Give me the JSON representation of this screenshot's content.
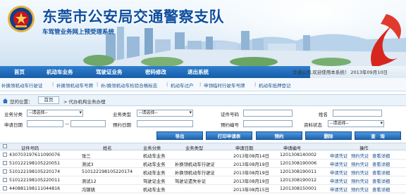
{
  "header": {
    "title": "东莞市公安局交通警察支队",
    "subtitle": "车驾管业务网上预受理系统",
    "welcome": "华通公司,欢迎使用本系统！ 2013年09月10日"
  },
  "main_nav": [
    "首页",
    "机动车业务",
    "驾驶证业务",
    "密码修改",
    "退出系统"
  ],
  "sub_nav": [
    "补换领机动车行驶证",
    "补换领机动车号牌",
    "补/换领机动车检验合格标志",
    "机动车过户",
    "申领临时行驶车号牌",
    "机动车抵押登记"
  ],
  "breadcrumb": {
    "label": "您的位置：",
    "home": "首页",
    "path": "> 代办机构业务办理"
  },
  "filters": {
    "business_category": {
      "label": "业务分类",
      "value": "--请选择--"
    },
    "business_type": {
      "label": "业务类型",
      "value": "--请选择--"
    },
    "certificate_no": {
      "label": "证件号码",
      "value": ""
    },
    "name": {
      "label": "姓名",
      "value": ""
    },
    "apply_date": {
      "label": "申请日期",
      "value": ""
    },
    "apply_date_sep": "—",
    "appointment_date": {
      "label": "预约日期",
      "value": ""
    },
    "appointment_no": {
      "label": "预约编号",
      "value": ""
    },
    "material_status": {
      "label": "资料状态",
      "value": "--请选择--"
    }
  },
  "buttons": [
    "导出",
    "打印申请表",
    "预约",
    "删除",
    "查　询"
  ],
  "table": {
    "headers": [
      "证件号码",
      "姓名",
      "业务分类",
      "业务类型",
      "申请日期",
      "申请编号",
      "操作"
    ],
    "rows": [
      {
        "id_no": "430703197611090076",
        "name": "张三",
        "category": "机动车业务",
        "type": "",
        "date": "2013年08月14日",
        "app_no": "1201308140002",
        "actions": [
          "申请凭证",
          "预约凭证",
          "查看详细"
        ]
      },
      {
        "id_no": "510122198105220051",
        "name": "测试3",
        "category": "机动车业务",
        "type": "补换领机动车行驶证",
        "date": "2013年08月19日",
        "app_no": "1201308190006",
        "actions": [
          "申请凭证",
          "预约凭证",
          "查看详细"
        ]
      },
      {
        "id_no": "510122198105220174",
        "name": "510122198105220174",
        "category": "机动车业务",
        "type": "补换领机动车行驶证",
        "date": "2013年08月19日",
        "app_no": "1201308190011",
        "actions": [
          "申请凭证",
          "预约凭证",
          "查看详细"
        ]
      },
      {
        "id_no": "510122198105220011",
        "name": "测试12",
        "category": "驾驶证业务",
        "type": "驾驶证遗失补证",
        "date": "2013年08月19日",
        "app_no": "1201308190012",
        "actions": [
          "申请凭证",
          "预约凭证",
          "查看详细"
        ]
      },
      {
        "id_no": "440881198111044816",
        "name": "冯钢锈",
        "category": "机动车业务",
        "type": "",
        "date": "2013年08月15日",
        "app_no": "1201308150001",
        "actions": [
          "申请凭证",
          "预约凭证",
          "查看详细"
        ]
      }
    ]
  },
  "colors": {
    "nav_blue": "#165ea9",
    "title_blue": "#0d4f9e",
    "link_blue": "#1b4f8f",
    "emblem_red": "#c8161d",
    "emblem_gold": "#e3b23c"
  },
  "icons": [
    "police-emblem-icon",
    "home-icon",
    "checkbox-icon"
  ]
}
